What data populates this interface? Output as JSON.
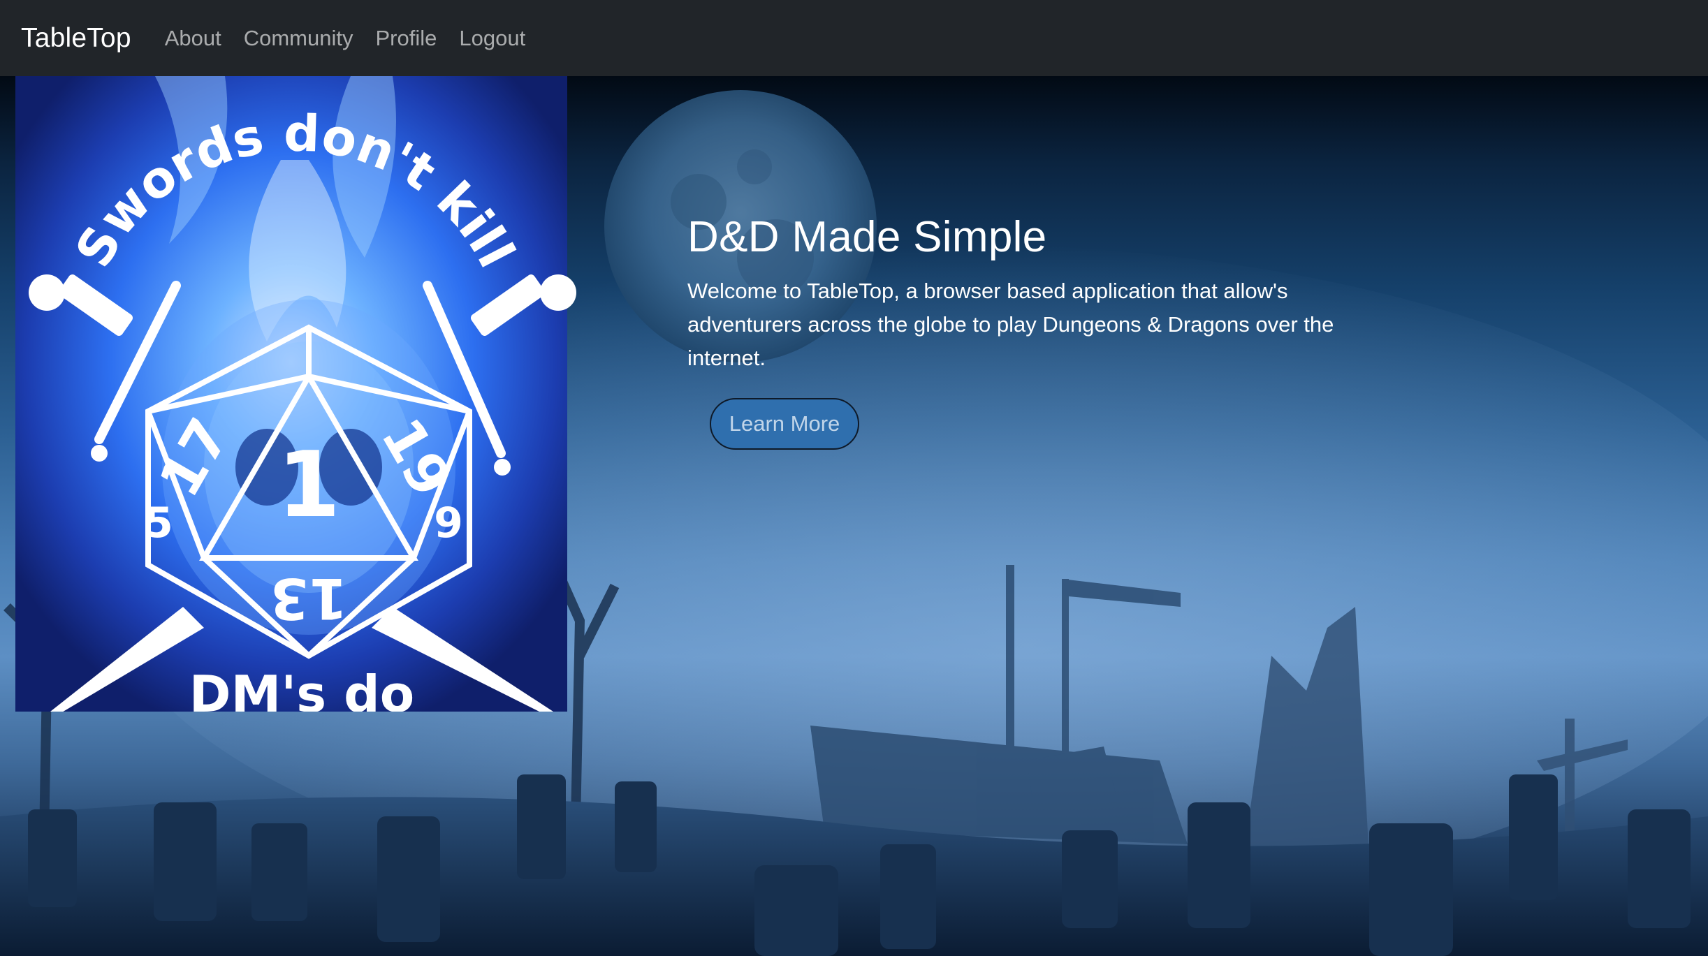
{
  "navbar": {
    "brand": "TableTop",
    "links": [
      "About",
      "Community",
      "Profile",
      "Logout"
    ]
  },
  "hero": {
    "title": "D&D Made Simple",
    "description": "Welcome to TableTop, a browser based application that allow's adventurers across the globe to play Dungeons & Dragons over the internet.",
    "cta_label": "Learn More"
  },
  "logo": {
    "top_text": "Swords don't kill",
    "bottom_text": "DM's do",
    "die_numbers": [
      "1",
      "19",
      "17",
      "13",
      "5",
      "9"
    ]
  },
  "colors": {
    "navbar_bg": "#212529",
    "button_bg": "#2f6fae",
    "hero_blue": "#4a7fb5",
    "flame_blue": "#3b7bff"
  }
}
